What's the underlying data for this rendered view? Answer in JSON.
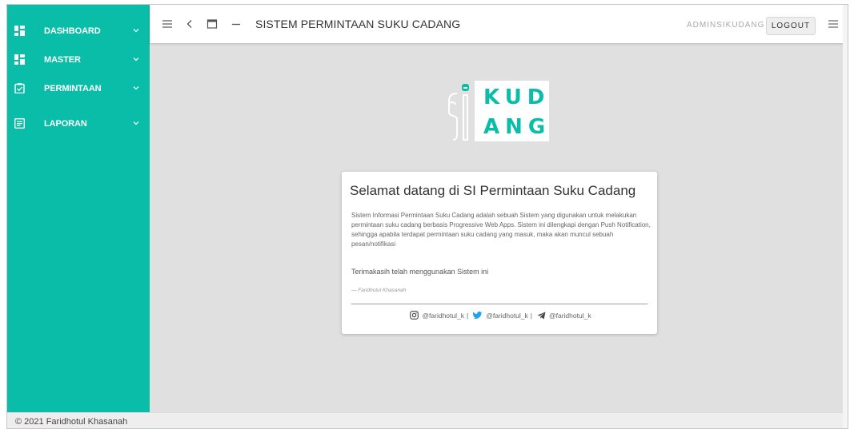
{
  "sidebar": {
    "items": [
      {
        "label": "DASHBOARD",
        "icon": "dashboard-icon"
      },
      {
        "label": "MASTER",
        "icon": "dashboard-icon"
      },
      {
        "label": "PERMINTAAN",
        "icon": "clipboard-check-icon"
      },
      {
        "label": "LAPORAN",
        "icon": "article-icon"
      }
    ]
  },
  "topbar": {
    "title": "SISTEM PERMINTAAN SUKU CADANG",
    "user": "ADMINSIKUDANG",
    "logout_label": "LOGOUT"
  },
  "logo": {
    "line1": "KUD",
    "line2": "ANG"
  },
  "welcome": {
    "heading": "Selamat datang di SI Permintaan Suku Cadang",
    "description": "Sistem Informasi Permintaan Suku Cadang adalah sebuah Sistem yang digunakan untuk melakukan permintaan suku cadang berbasis Progressive Web Apps. Sistem ini dilengkapi dengan Push Notification, sehingga apabila terdapat permintaan suku cadang yang masuk, maka akan muncul sebuah pesan/notifikasi",
    "thanks": "Terimakasih telah menggunakan Sistem ini",
    "author": "— Faridhotul Khasanah",
    "social": {
      "instagram": "@faridhotul_k",
      "twitter": "@faridhotul_k",
      "telegram": "@faridhotul_k",
      "separator": "|"
    }
  },
  "footer": {
    "text": "© 2021 Faridhotul Khasanah"
  },
  "colors": {
    "accent": "#0abda8",
    "background": "#e0e0e0"
  }
}
